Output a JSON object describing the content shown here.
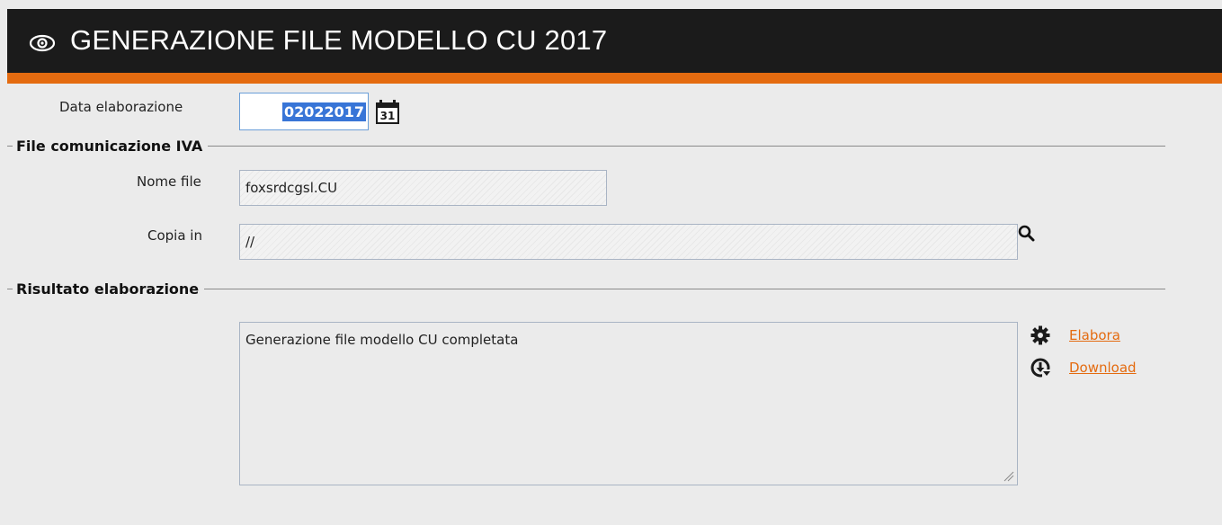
{
  "header": {
    "title": "GENERAZIONE FILE MODELLO CU 2017",
    "icon": "eye-icon"
  },
  "form": {
    "data_elaborazione": {
      "label": "Data elaborazione",
      "value": "02022017",
      "icon": "calendar-icon",
      "calendar_day": "31"
    }
  },
  "section_file": {
    "title": "File comunicazione IVA",
    "nome_file": {
      "label": "Nome file",
      "value": "foxsrdcgsl.CU"
    },
    "copia_in": {
      "label": "Copia in",
      "value": "//",
      "icon": "search-icon"
    }
  },
  "section_result": {
    "title": "Risultato elaborazione",
    "result_text": "Generazione file modello CU completata",
    "actions": [
      {
        "label": "Elabora",
        "icon": "gear-icon"
      },
      {
        "label": "Download",
        "icon": "download-icon"
      }
    ]
  },
  "colors": {
    "accent": "#e46b10",
    "header_bg": "#1b1b1b",
    "selection": "#3875d7",
    "background": "#ebebeb"
  }
}
